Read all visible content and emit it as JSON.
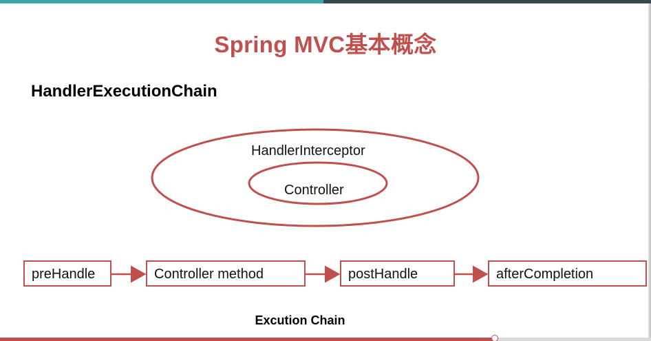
{
  "slide": {
    "title": "Spring MVC基本概念",
    "heading": "HandlerExecutionChain"
  },
  "diagram": {
    "outer_label": "HandlerInterceptor",
    "inner_label": "Controller",
    "steps": [
      {
        "label": "preHandle"
      },
      {
        "label": "Controller method"
      },
      {
        "label": "postHandle"
      },
      {
        "label": "afterCompletion"
      }
    ],
    "caption": "Excution Chain"
  },
  "player": {
    "progress": 0.76
  },
  "colors": {
    "accent": "#c0504d",
    "top_bar_left": "#3aa6b0",
    "top_bar_right": "#37474f"
  }
}
